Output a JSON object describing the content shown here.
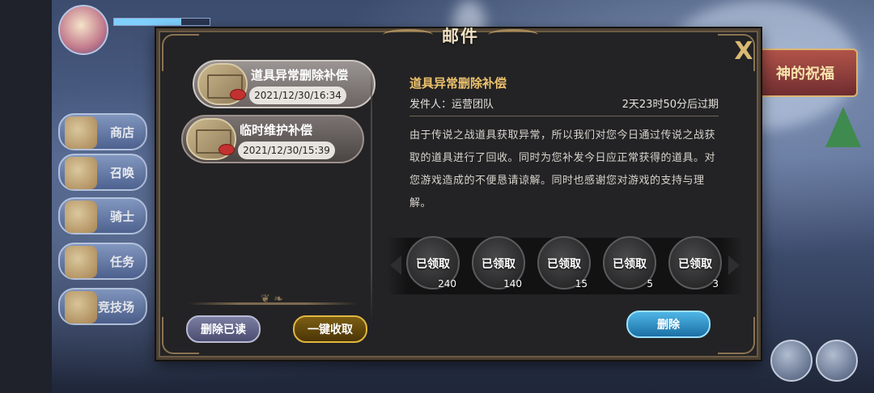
{
  "dialog": {
    "title": "邮件",
    "close_label": "X"
  },
  "mail_list": [
    {
      "title": "道具异常删除补偿",
      "date": "2021/12/30/16:34",
      "active": true
    },
    {
      "title": "临时维护补偿",
      "date": "2021/12/30/15:39",
      "active": false
    }
  ],
  "detail": {
    "subject": "道具异常删除补偿",
    "sender": "发件人：运营团队",
    "expiry": "2天23时50分后过期",
    "body": "由于传说之战道具获取异常，所以我们对您今日通过传说之战获取的道具进行了回收。同时为您补发今日应正常获得的道具。对您游戏造成的不便恳请谅解。同时也感谢您对游戏的支持与理解。"
  },
  "rewards": [
    {
      "label": "已领取",
      "qty": "240"
    },
    {
      "label": "已领取",
      "qty": "140"
    },
    {
      "label": "已领取",
      "qty": "15"
    },
    {
      "label": "已领取",
      "qty": "5"
    },
    {
      "label": "已领取",
      "qty": "3"
    }
  ],
  "buttons": {
    "delete_read": "删除已读",
    "claim_all": "一键收取",
    "delete": "删除"
  },
  "background": {
    "side_menu": [
      "商店",
      "召唤",
      "骑士",
      "任务",
      "竞技场"
    ],
    "banner": "神的祝福"
  }
}
